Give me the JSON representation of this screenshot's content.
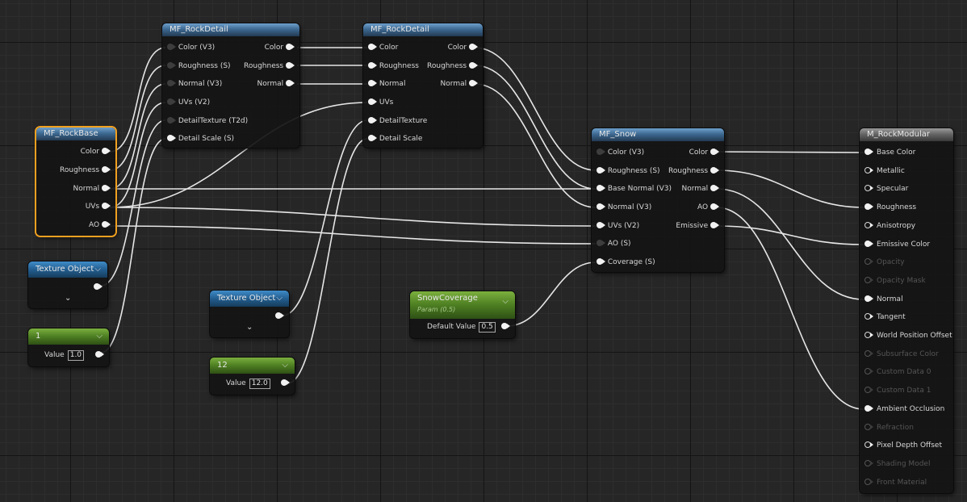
{
  "nodes": {
    "rockbase": {
      "title": "MF_RockBase",
      "outputs": [
        "Color",
        "Roughness",
        "Normal",
        "UVs",
        "AO"
      ]
    },
    "rockdetail1": {
      "title": "MF_RockDetail",
      "inputs": [
        "Color (V3)",
        "Roughness (S)",
        "Normal (V3)",
        "UVs (V2)",
        "DetailTexture (T2d)",
        "Detail Scale (S)"
      ],
      "outputs": [
        "Color",
        "Roughness",
        "Normal"
      ]
    },
    "rockdetail2": {
      "title": "MF_RockDetail",
      "inputs": [
        "Color",
        "Roughness",
        "Normal",
        "UVs",
        "DetailTexture",
        "Detail Scale"
      ],
      "outputs": [
        "Color",
        "Roughness",
        "Normal"
      ]
    },
    "snow": {
      "title": "MF_Snow",
      "inputs": [
        "Color (V3)",
        "Roughness (S)",
        "Base Normal (V3)",
        "Normal (V3)",
        "UVs (V2)",
        "AO (S)",
        "Coverage (S)"
      ],
      "outputs": [
        "Color",
        "Roughness",
        "Normal",
        "AO",
        "Emissive"
      ]
    },
    "material": {
      "title": "M_RockModular",
      "inputs": [
        "Base Color",
        "Metallic",
        "Specular",
        "Roughness",
        "Anisotropy",
        "Emissive Color",
        "Opacity",
        "Opacity Mask",
        "Normal",
        "Tangent",
        "World Position Offset",
        "Subsurface Color",
        "Custom Data 0",
        "Custom Data 1",
        "Ambient Occlusion",
        "Refraction",
        "Pixel Depth Offset",
        "Shading Model",
        "Front Material"
      ]
    },
    "texobj1": {
      "title": "Texture Object",
      "chevron": "⌄"
    },
    "texobj2": {
      "title": "Texture Object",
      "chevron": "⌄"
    },
    "const1": {
      "title": "1",
      "value_label": "Value",
      "value": "1.0"
    },
    "const12": {
      "title": "12",
      "value_label": "Value",
      "value": "12.0"
    },
    "snowcoverage": {
      "title": "SnowCoverage",
      "subtitle": "Param (0.5)",
      "value_label": "Default Value",
      "value": "0.5"
    }
  },
  "colors": {
    "background": "#262626",
    "wire": "#e6e6e6",
    "selection": "#f0a020",
    "function_header": "#3d6991",
    "texture_header": "#235e90",
    "scalar_header": "#4d7e22",
    "material_header": "#666666"
  }
}
